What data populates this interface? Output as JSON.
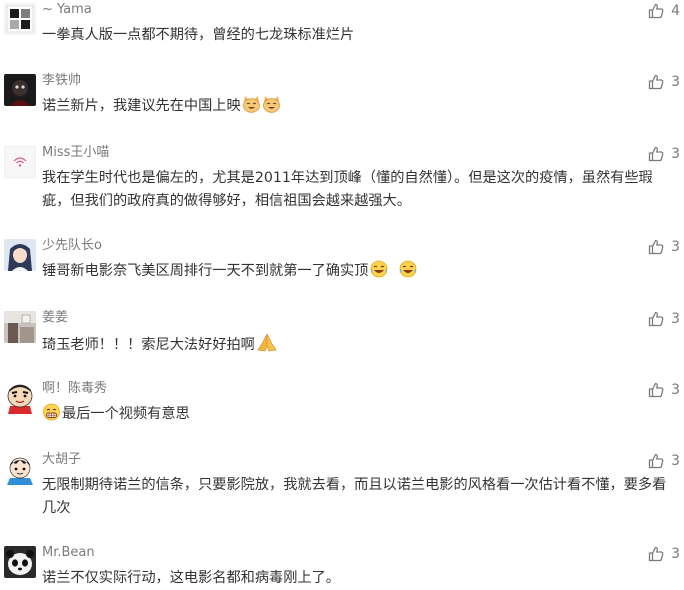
{
  "comments": [
    {
      "user": "~ Yama",
      "text": "一拳真人版一点都不期待，曾经的七龙珠标准烂片",
      "likes": "4",
      "avatar": "geometric-avatar",
      "emojis": []
    },
    {
      "user": "李铁帅",
      "text": "诺兰新片，我建议先在中国上映",
      "likes": "3",
      "avatar": "dark-photo-avatar",
      "emojis": [
        "cat-emoji",
        "cat-emoji"
      ]
    },
    {
      "user": "Miss王小喵",
      "text": "我在学生时代也是偏左的，尤其是2011年达到顶峰（懂的自然懂）。但是这次的疫情，虽然有些瑕疵，但我们的政府真的做得够好，相信祖国会越来越强大。",
      "likes": "3",
      "avatar": "wifi-logo-avatar",
      "emojis": []
    },
    {
      "user": "少先队长o",
      "text": "锤哥新电影奈飞美区周排行一天不到就第一了确实顶",
      "likes": "3",
      "avatar": "anime-girl-avatar",
      "emojis": [
        "laugh-tears-emoji",
        "laugh-tears-emoji"
      ]
    },
    {
      "user": "姜姜",
      "text": "琦玉老师！！！索尼大法好好拍啊",
      "likes": "3",
      "avatar": "room-photo-avatar",
      "emojis": [
        "pray-emoji"
      ]
    },
    {
      "user": "啊！陈毒秀",
      "text": "最后一个视频有意思",
      "likes": "3",
      "avatar": "shinchan-avatar",
      "emojis": [
        "grin-emoji"
      ],
      "emoji_first": true
    },
    {
      "user": "大胡子",
      "text": "无限制期待诺兰的信条，只要影院放，我就去看，而且以诺兰电影的风格看一次估计看不懂，要多看几次",
      "likes": "3",
      "avatar": "cartoon-boy-avatar",
      "emojis": []
    },
    {
      "user": "Mr.Bean",
      "text": "诺兰不仅实际行动，这电影名都和病毒刚上了。",
      "likes": "3",
      "avatar": "panda-avatar",
      "emojis": []
    }
  ]
}
